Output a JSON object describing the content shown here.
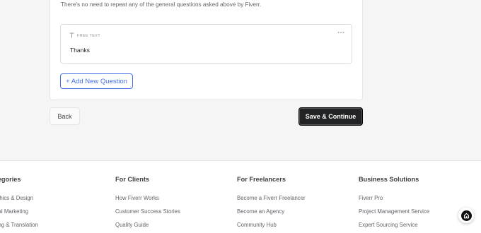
{
  "form": {
    "info_text": "There's no need to repeat any of the general questions asked above by Fiverr.",
    "question": {
      "type_label": "FREE TEXT",
      "type_icon": "text-icon",
      "menu_icon": "more-horizontal-icon",
      "text": "Thanks"
    },
    "add_question_label": "+ Add New Question"
  },
  "actions": {
    "back_label": "Back",
    "save_label": "Save & Continue"
  },
  "footer": {
    "columns": [
      {
        "title": "Categories",
        "links": [
          "Graphics & Design",
          "Digital Marketing",
          "Writing & Translation"
        ]
      },
      {
        "title": "For Clients",
        "links": [
          "How Fiverr Works",
          "Customer Success Stories",
          "Quality Guide"
        ]
      },
      {
        "title": "For Freelancers",
        "links": [
          "Become a Fiverr Freelancer",
          "Become an Agency",
          "Community Hub"
        ]
      },
      {
        "title": "Business Solutions",
        "links": [
          "Fiverr Pro",
          "Project Management Service",
          "Expert Sourcing Service"
        ]
      }
    ]
  },
  "chat_widget": {
    "icon": "chat-assistant-icon"
  },
  "colors": {
    "accent": "#446ee7",
    "primary_button": "#222325"
  }
}
